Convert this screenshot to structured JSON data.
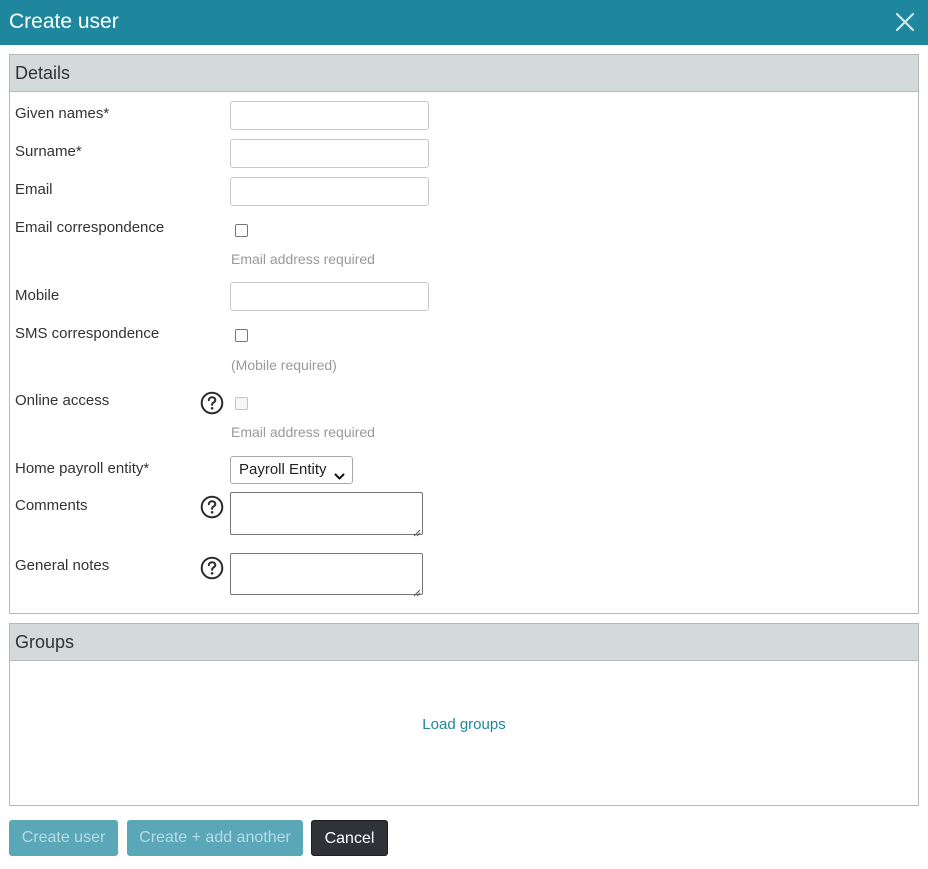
{
  "dialog": {
    "title": "Create user",
    "close_icon": "close-icon"
  },
  "details": {
    "heading": "Details",
    "given_names": {
      "label": "Given names*",
      "value": ""
    },
    "surname": {
      "label": "Surname*",
      "value": ""
    },
    "email": {
      "label": "Email",
      "value": ""
    },
    "email_correspondence": {
      "label": "Email correspondence",
      "checked": false,
      "hint": "Email address required"
    },
    "mobile": {
      "label": "Mobile",
      "value": ""
    },
    "sms_correspondence": {
      "label": "SMS correspondence",
      "checked": false,
      "hint": "(Mobile required)"
    },
    "online_access": {
      "label": "Online access",
      "checked": false,
      "disabled": true,
      "hint": "Email address required"
    },
    "home_payroll_entity": {
      "label": "Home payroll entity*",
      "selected": "Payroll Entity"
    },
    "comments": {
      "label": "Comments",
      "value": ""
    },
    "general_notes": {
      "label": "General notes",
      "value": ""
    }
  },
  "groups": {
    "heading": "Groups",
    "load_link": "Load groups"
  },
  "footer": {
    "create_user": "Create user",
    "create_add_another": "Create + add another",
    "cancel": "Cancel"
  },
  "colors": {
    "accent": "#1f879d",
    "panel_header": "#d4d9da",
    "dark_button": "#2f3337",
    "hint": "#999999"
  }
}
